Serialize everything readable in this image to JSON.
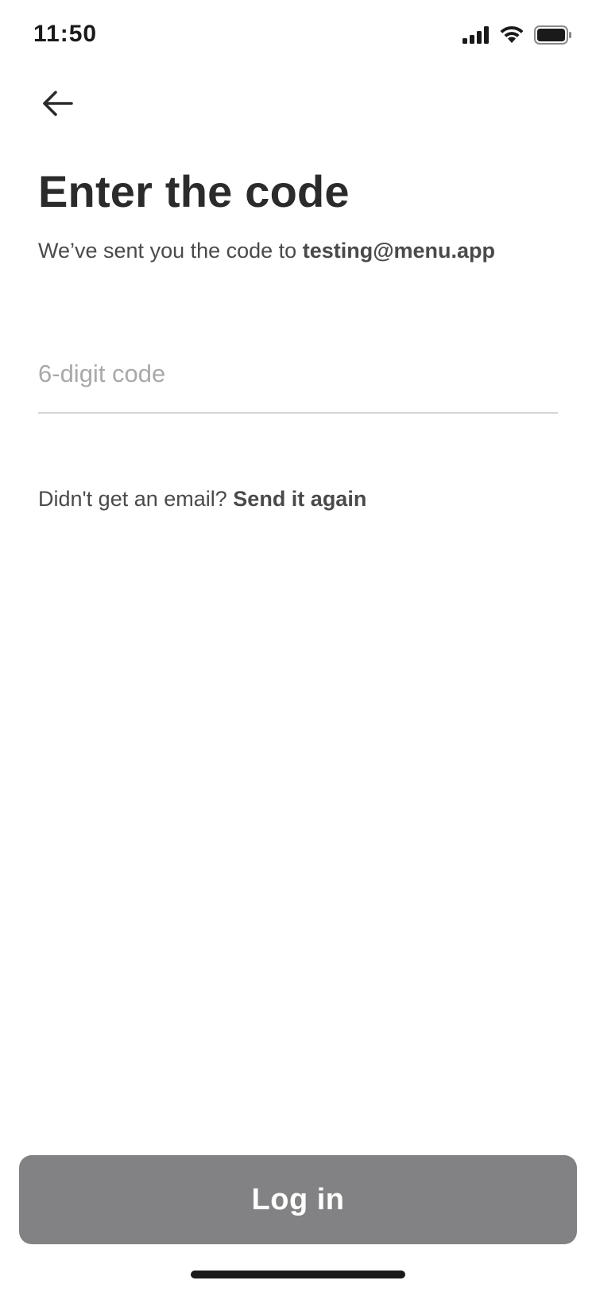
{
  "status_bar": {
    "time": "11:50",
    "icons": [
      "signal-icon",
      "wifi-icon",
      "battery-icon"
    ]
  },
  "header": {
    "back_icon": "arrow-left-icon"
  },
  "main": {
    "title": "Enter the code",
    "subtitle_prefix": "We’ve sent you the code to ",
    "email": "testing@menu.app",
    "code_placeholder": "6-digit code",
    "code_value": "",
    "resend_prefix": "Didn't get an email? ",
    "resend_link": "Send it again"
  },
  "footer": {
    "login_label": "Log in"
  },
  "colors": {
    "text_primary": "#2b2b2b",
    "text_secondary": "#4a4a4a",
    "placeholder": "#a9a9a9",
    "button_disabled": "#828284",
    "divider": "#d6d6d6"
  }
}
